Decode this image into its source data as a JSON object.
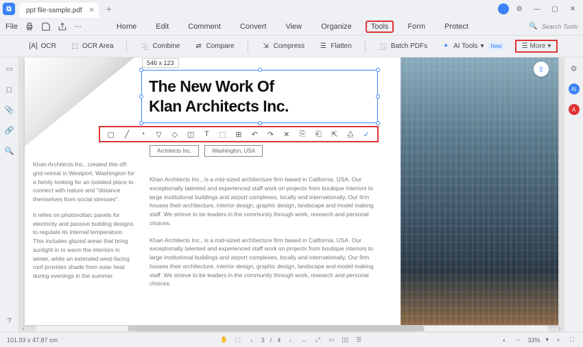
{
  "tab": {
    "title": "ppt file-sample.pdf"
  },
  "menubar": {
    "file": "File"
  },
  "menu": {
    "home": "Home",
    "edit": "Edit",
    "comment": "Comment",
    "convert": "Convert",
    "view": "View",
    "organize": "Organize",
    "tools": "Tools",
    "form": "Form",
    "protect": "Protect",
    "search": "Search Tools"
  },
  "toolbar": {
    "ocr": "OCR",
    "ocr_area": "OCR Area",
    "combine": "Combine",
    "compare": "Compare",
    "compress": "Compress",
    "flatten": "Flatten",
    "batch": "Batch PDFs",
    "ai_tools": "AI Tools",
    "ai_pill": "New",
    "more": "More"
  },
  "selection": {
    "dimensions": "546 x 123"
  },
  "heading": {
    "line1": "The New Work Of",
    "line2": "Klan Architects Inc."
  },
  "tags": {
    "t1": "Architects Inc.",
    "t2": "Washington, USA"
  },
  "body": {
    "left_p1": "Khan Architects Inc., created this off-grid retreat in Westport, Washington for a family looking for an isolated place to connect with nature and \"distance themselves from social stresses\".",
    "left_p2": "It relies on photovoltaic panels for electricity and passive building designs to regulate its internal temperature. This includes glazed areas that bring sunlight in to warm the interiors in winter, while an extended west-facing roof provides shade from solar heat during evenings in the summer.",
    "right_p1": "Khan Architects Inc., is a mid-sized architecture firm based in California, USA. Our exceptionally talented and experienced staff work on projects from boutique interiors to large institutional buildings and airport complexes, locally and internationally. Our firm houses their architecture, interior design, graphic design, landscape and model making staff. We strieve to be leaders in the community through work, research and personal choices.",
    "right_p2": "Khan Architects Inc., is a mid-sized architecture firm based in California, USA. Our exceptionally talented and experienced staff work on projects from boutique interiors to large institutional buildings and airport complexes, locally and internationally. Our firm houses their architecture, interior design, graphic design, landscape and model making staff. We strieve to be leaders in the community through work, research and personal choices."
  },
  "status": {
    "coords": "101.93 x 47.87 cm",
    "page_current": "3",
    "page_total": "4",
    "zoom": "33%"
  }
}
